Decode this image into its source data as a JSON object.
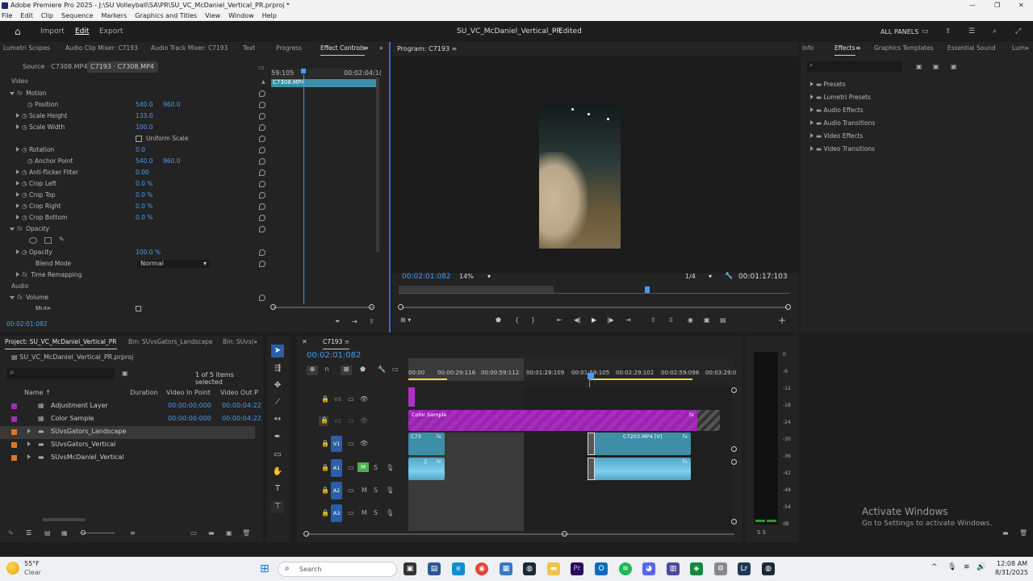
{
  "window": {
    "title": "Adobe Premiere Pro 2025 - J:\\SU Volleyball\\SA\\PR\\SU_VC_McDaniel_Vertical_PR.prproj *"
  },
  "menu": [
    "File",
    "Edit",
    "Clip",
    "Sequence",
    "Markers",
    "Graphics and Titles",
    "View",
    "Window",
    "Help"
  ],
  "header": {
    "import": "Import",
    "edit": "Edit",
    "export": "Export",
    "project_title": "SU_VC_McDaniel_Vertical_PR",
    "status": "- Edited",
    "all_panels": "ALL PANELS"
  },
  "effect_panel": {
    "tabs": [
      "Lumetri Scopes",
      "Audio Clip Mixer: C7193",
      "Audio Track Mixer: C7193",
      "Text",
      "Progress",
      "Effect Controls"
    ],
    "source": "Source · C7308.MP4",
    "clip": "C7193 · C7308.MP4",
    "ruler_start": "59:105",
    "ruler_end": "00:02:04:1(",
    "clip_label": "C7308.MP4",
    "section_video": "Video",
    "section_audio": "Audio",
    "props": [
      {
        "name": "Motion",
        "v1": "",
        "v2": ""
      },
      {
        "name": "Position",
        "v1": "540.0",
        "v2": "960.0"
      },
      {
        "name": "Scale Height",
        "v1": "133.0",
        "v2": ""
      },
      {
        "name": "Scale Width",
        "v1": "100.0",
        "v2": ""
      },
      {
        "name": "Uniform Scale",
        "v1": "",
        "v2": ""
      },
      {
        "name": "Rotation",
        "v1": "0.0",
        "v2": ""
      },
      {
        "name": "Anchor Point",
        "v1": "540.0",
        "v2": "960.0"
      },
      {
        "name": "Anti-flicker Filter",
        "v1": "0.00",
        "v2": ""
      },
      {
        "name": "Crop Left",
        "v1": "0.0 %",
        "v2": ""
      },
      {
        "name": "Crop Top",
        "v1": "0.0 %",
        "v2": ""
      },
      {
        "name": "Crop Right",
        "v1": "0.0 %",
        "v2": ""
      },
      {
        "name": "Crop Bottom",
        "v1": "0.0 %",
        "v2": ""
      },
      {
        "name": "Opacity",
        "v1": "",
        "v2": ""
      },
      {
        "name": "Opacity",
        "v1": "100.0 %",
        "v2": ""
      },
      {
        "name": "Blend Mode",
        "v1": "Normal",
        "v2": ""
      },
      {
        "name": "Time Remapping",
        "v1": "",
        "v2": ""
      },
      {
        "name": "Volume",
        "v1": "",
        "v2": ""
      },
      {
        "name": "Mute",
        "v1": "",
        "v2": ""
      }
    ],
    "timecode": "00:02:01:082"
  },
  "program": {
    "label": "Program: C7193",
    "timecode": "00:02:01:082",
    "zoom": "14%",
    "quality": "1/4",
    "duration": "00:01:17:103"
  },
  "effects_panel": {
    "tabs": [
      "Info",
      "Effects",
      "Graphics Templates",
      "Essential Sound",
      "Lum"
    ],
    "items": [
      "Presets",
      "Lumetri Presets",
      "Audio Effects",
      "Audio Transitions",
      "Video Effects",
      "Video Transitions"
    ]
  },
  "project": {
    "tabs": [
      "Project: SU_VC_McDaniel_Vertical_PR",
      "Bin: SUvsGators_Landscape",
      "Bin: SUvs("
    ],
    "file": "SU_VC_McDaniel_Vertical_PR.prproj",
    "selected": "1 of 5 items selected",
    "cols": [
      "Name",
      "Duration",
      "Video In Point",
      "Video Out P"
    ],
    "items": [
      {
        "name": "Adjustment Layer",
        "in": "00:00:00:000",
        "out": "00:00:04:22",
        "color": "#9b30b0"
      },
      {
        "name": "Color Sample",
        "in": "00:00:00:000",
        "out": "00:00:04:22",
        "color": "#9b30b0"
      },
      {
        "name": "SUvsGators_Landscape",
        "in": "",
        "out": "",
        "color": "#d9782a"
      },
      {
        "name": "SUvsGators_Vertical",
        "in": "",
        "out": "",
        "color": "#d9782a"
      },
      {
        "name": "SUvsMcDaniel_Vertical",
        "in": "",
        "out": "",
        "color": "#d9782a"
      }
    ]
  },
  "timeline": {
    "seq": "C7193",
    "timecode": "00:02:01:082",
    "ruler": [
      "00:00",
      "00:00:29:116",
      "00:00:59:112",
      "00:01:29:109",
      "00:01:59:105",
      "00:02:29:102",
      "00:02:59:098",
      "00:03:29:0"
    ],
    "tracks": [
      "V3",
      "V2",
      "V1",
      "A1",
      "A2",
      "A3"
    ],
    "clips": {
      "color_sample": "Color Sample",
      "c73": "C73",
      "c7203": "C7203.MP4 [V]"
    }
  },
  "meter": {
    "labels": [
      "0",
      "-6",
      "-12",
      "-18",
      "-24",
      "-30",
      "-36",
      "-42",
      "-48",
      "-54",
      "dB"
    ],
    "ss": "S  S"
  },
  "watermark": {
    "title": "Activate Windows",
    "sub": "Go to Settings to activate Windows."
  },
  "taskbar": {
    "weather_temp": "55°F",
    "weather": "Clear",
    "search": "Search",
    "time": "12:08 AM",
    "date": "8/31/2025"
  }
}
